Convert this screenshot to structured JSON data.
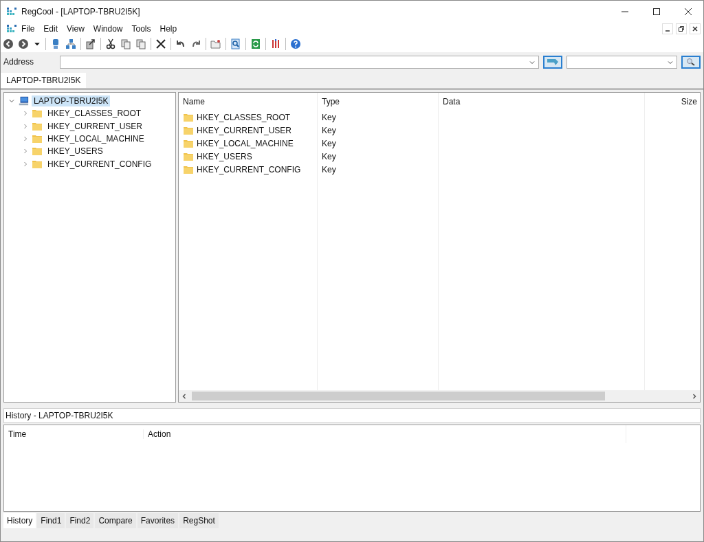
{
  "window": {
    "title": "RegCool - [LAPTOP-TBRU2I5K]"
  },
  "menu": [
    "File",
    "Edit",
    "View",
    "Window",
    "Tools",
    "Help"
  ],
  "address": {
    "label": "Address"
  },
  "document_tabs": [
    {
      "label": "LAPTOP-TBRU2I5K",
      "selected": true
    }
  ],
  "tree": {
    "label": "LAPTOP-TBRU2I5K",
    "expanded": true,
    "selected": true,
    "children": [
      {
        "label": "HKEY_CLASSES_ROOT",
        "expanded": false,
        "selected": false
      },
      {
        "label": "HKEY_CURRENT_USER",
        "expanded": false,
        "selected": false
      },
      {
        "label": "HKEY_LOCAL_MACHINE",
        "expanded": false,
        "selected": false
      },
      {
        "label": "HKEY_USERS",
        "expanded": false,
        "selected": false
      },
      {
        "label": "HKEY_CURRENT_CONFIG",
        "expanded": false,
        "selected": false
      }
    ]
  },
  "table": {
    "columns": [
      "Name",
      "Type",
      "Data",
      "Size"
    ],
    "rows": [
      {
        "name": "HKEY_CLASSES_ROOT",
        "type": "Key"
      },
      {
        "name": "HKEY_CURRENT_USER",
        "type": "Key"
      },
      {
        "name": "HKEY_LOCAL_MACHINE",
        "type": "Key"
      },
      {
        "name": "HKEY_USERS",
        "type": "Key"
      },
      {
        "name": "HKEY_CURRENT_CONFIG",
        "type": "Key"
      }
    ]
  },
  "history": {
    "title": "History - LAPTOP-TBRU2I5K",
    "columns": [
      "Time",
      "Action"
    ]
  },
  "bottom_tabs": [
    {
      "label": "History",
      "selected": true
    },
    {
      "label": "Find1",
      "selected": false
    },
    {
      "label": "Find2",
      "selected": false
    },
    {
      "label": "Compare",
      "selected": false
    },
    {
      "label": "Favorites",
      "selected": false
    },
    {
      "label": "RegShot",
      "selected": false
    }
  ]
}
